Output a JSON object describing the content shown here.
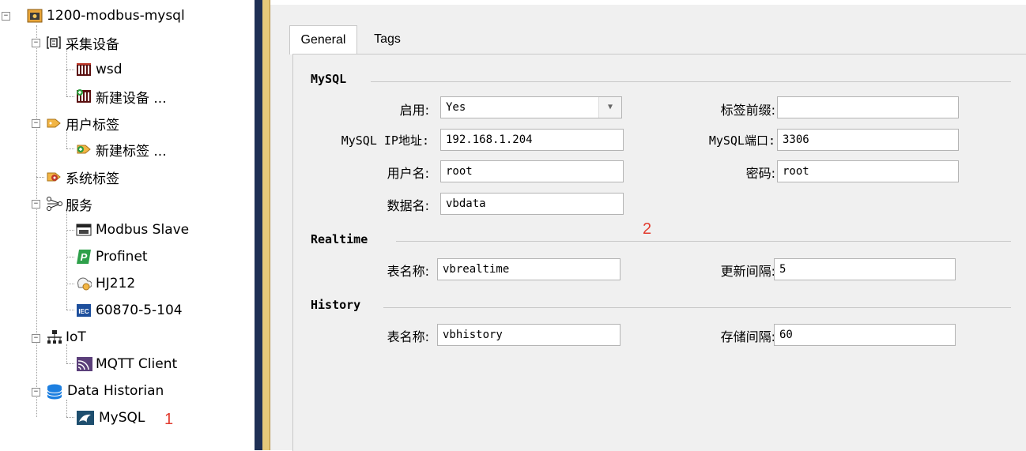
{
  "tree": {
    "root": "1200-modbus-mysql",
    "devices_group": "采集设备",
    "device_wsd": "wsd",
    "new_device": "新建设备 ...",
    "user_tags": "用户标签",
    "new_tag": "新建标签 ...",
    "system_tags": "系统标签",
    "services": "服务",
    "modbus_slave": "Modbus Slave",
    "profinet": "Profinet",
    "hj212": "HJ212",
    "iec104": "60870-5-104",
    "iot": "IoT",
    "mqtt_client": "MQTT Client",
    "data_historian": "Data Historian",
    "mysql": "MySQL",
    "marker": "1",
    "icon_text": {
      "profinet": "P",
      "iec": "IEC"
    }
  },
  "tabs": {
    "general": "General",
    "tags": "Tags"
  },
  "mysql_section": {
    "title": "MySQL",
    "enable_label": "启用:",
    "enable_value": "Yes",
    "tag_prefix_label": "标签前缀:",
    "tag_prefix_value": "",
    "ip_label": "MySQL IP地址:",
    "ip_value": "192.168.1.204",
    "port_label": "MySQL端口:",
    "port_value": "3306",
    "username_label": "用户名:",
    "username_value": "root",
    "password_label": "密码:",
    "password_value": "root",
    "database_label": "数据名:",
    "database_value": "vbdata",
    "marker": "2"
  },
  "realtime_section": {
    "title": "Realtime",
    "table_label": "表名称:",
    "table_value": "vbrealtime",
    "interval_label": "更新间隔:",
    "interval_value": "5"
  },
  "history_section": {
    "title": "History",
    "table_label": "表名称:",
    "table_value": "vbhistory",
    "interval_label": "存储间隔:",
    "interval_value": "60"
  },
  "colors": {
    "marker": "#e23b2e",
    "splitter": "#1f3055",
    "accent_border": "#e6c97a"
  }
}
